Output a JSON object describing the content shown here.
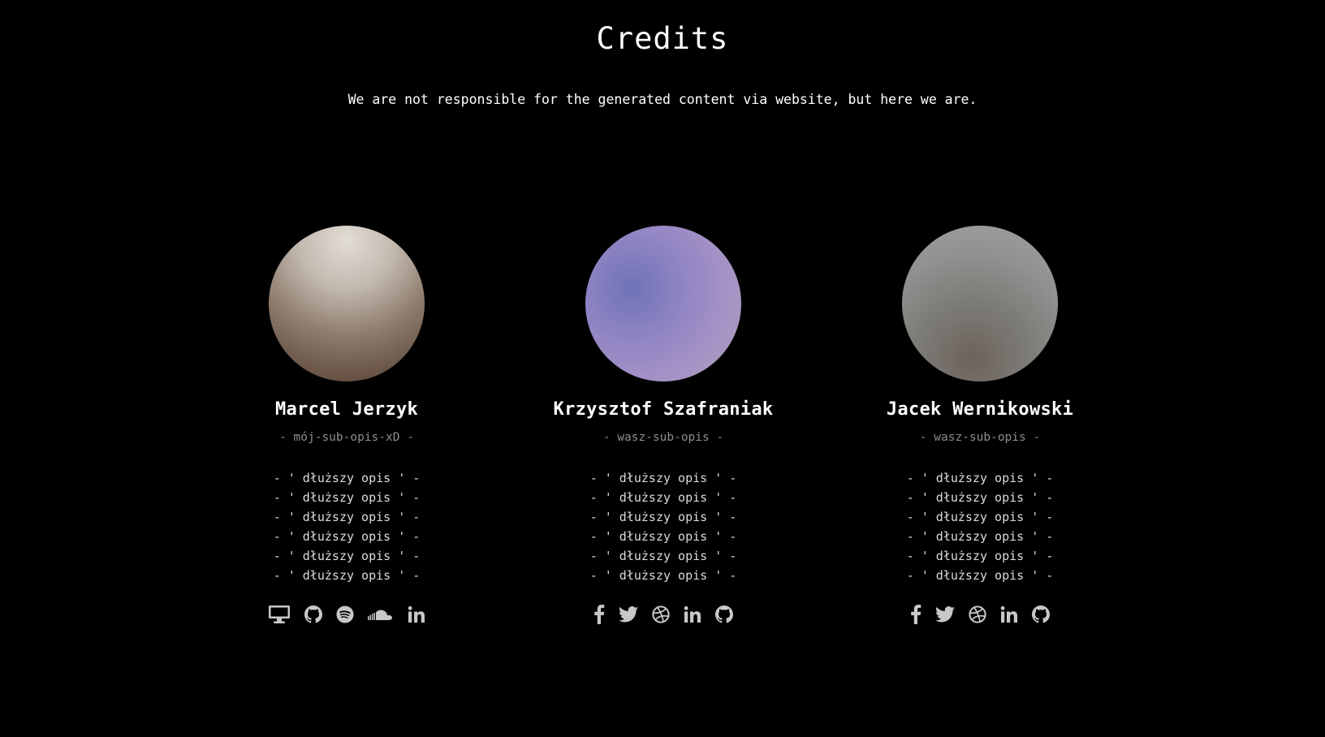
{
  "header": {
    "title": "Credits",
    "subtitle": "We are not responsible for the generated content via website, but here we are."
  },
  "team": [
    {
      "name": "Marcel Jerzyk",
      "sub": "- mój-sub-opis-xD -",
      "desc": [
        "- ' dłuższy opis ' -",
        "- ' dłuższy opis ' -",
        "- ' dłuższy opis ' -",
        "- ' dłuższy opis ' -",
        "- ' dłuższy opis ' -",
        "- ' dłuższy opis ' -"
      ],
      "socials": [
        "desktop-icon",
        "github-icon",
        "spotify-icon",
        "soundcloud-icon",
        "linkedin-icon"
      ]
    },
    {
      "name": "Krzysztof Szafraniak",
      "sub": "- wasz-sub-opis -",
      "desc": [
        "- ' dłuższy opis ' -",
        "- ' dłuższy opis ' -",
        "- ' dłuższy opis ' -",
        "- ' dłuższy opis ' -",
        "- ' dłuższy opis ' -",
        "- ' dłuższy opis ' -"
      ],
      "socials": [
        "facebook-icon",
        "twitter-icon",
        "dribbble-icon",
        "linkedin-icon",
        "github-icon"
      ]
    },
    {
      "name": "Jacek Wernikowski",
      "sub": "- wasz-sub-opis -",
      "desc": [
        "- ' dłuższy opis ' -",
        "- ' dłuższy opis ' -",
        "- ' dłuższy opis ' -",
        "- ' dłuższy opis ' -",
        "- ' dłuższy opis ' -",
        "- ' dłuższy opis ' -"
      ],
      "socials": [
        "facebook-icon",
        "twitter-icon",
        "dribbble-icon",
        "linkedin-icon",
        "github-icon"
      ]
    }
  ],
  "colors": {
    "background": "#000000",
    "text": "#ffffff",
    "muted": "#8e8e8e",
    "icon": "#c8c8c8"
  }
}
